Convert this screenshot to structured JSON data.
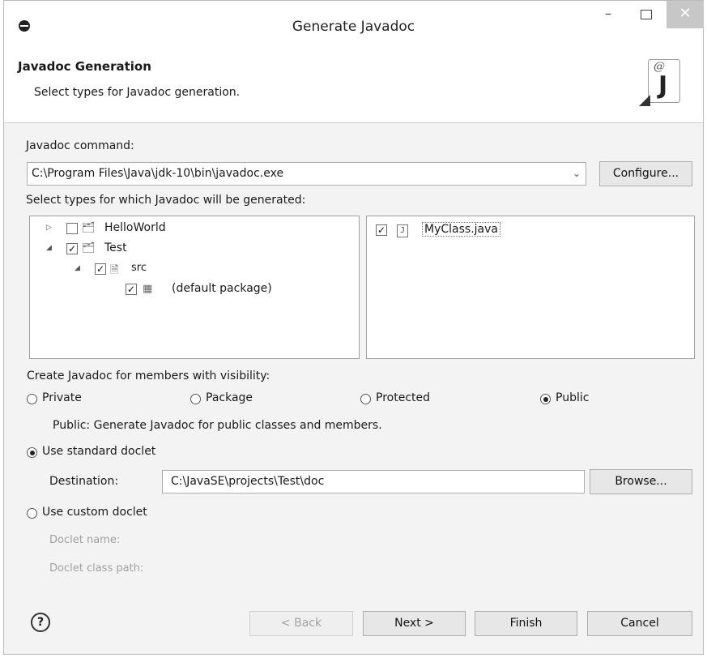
{
  "window": {
    "title": "Generate Javadoc",
    "minimize": "–",
    "close": "✕"
  },
  "banner": {
    "title": "Javadoc Generation",
    "subtitle": "Select types for Javadoc generation.",
    "icon_at": "@",
    "icon_j": "J"
  },
  "command": {
    "label": "Javadoc command:",
    "value": "C:\\Program Files\\Java\\jdk-10\\bin\\javadoc.exe",
    "configure": "Configure..."
  },
  "types": {
    "label": "Select types for which Javadoc will be generated:",
    "tree": [
      {
        "label": "HelloWorld",
        "expanded": false,
        "checked": false
      },
      {
        "label": "Test",
        "expanded": true,
        "checked": true
      },
      {
        "label": "src",
        "expanded": true,
        "checked": true
      },
      {
        "label": "(default package)",
        "checked": true
      }
    ],
    "files": [
      {
        "label": "MyClass.java",
        "checked": true
      }
    ]
  },
  "visibility": {
    "label": "Create Javadoc for members with visibility:",
    "options": [
      "Private",
      "Package",
      "Protected",
      "Public"
    ],
    "selected": "Public",
    "description": "Public: Generate Javadoc for public classes and members."
  },
  "doclet": {
    "standard_label": "Use standard doclet",
    "destination_label": "Destination:",
    "destination_value": "C:\\JavaSE\\projects\\Test\\doc",
    "browse": "Browse...",
    "custom_label": "Use custom doclet",
    "doclet_name_label": "Doclet name:",
    "doclet_classpath_label": "Doclet class path:",
    "selected": "standard"
  },
  "footer": {
    "help": "?",
    "back": "< Back",
    "next": "Next >",
    "finish": "Finish",
    "cancel": "Cancel"
  }
}
